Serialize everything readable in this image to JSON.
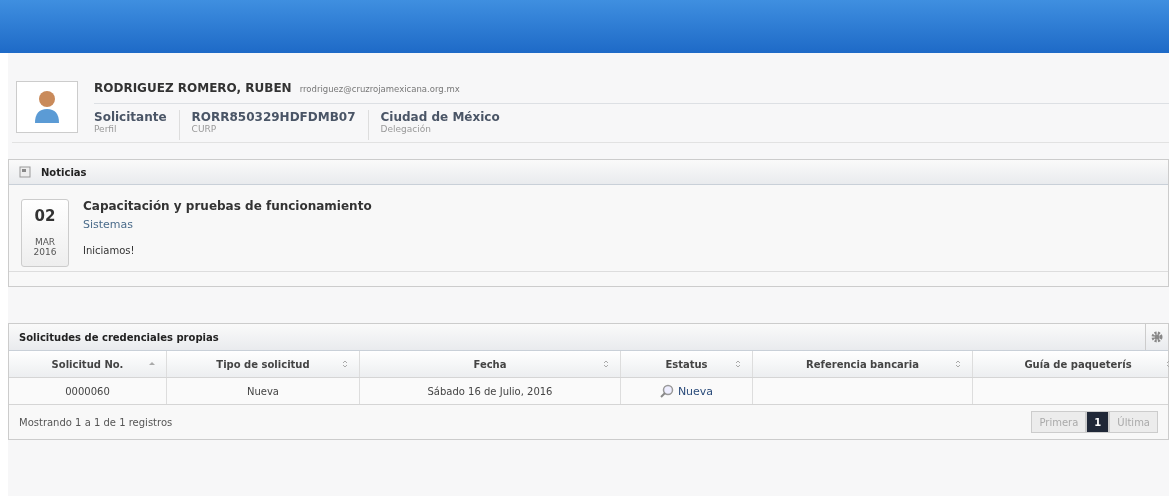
{
  "profile": {
    "name": "RODRIGUEZ ROMERO, RUBEN",
    "email": "rrodriguez@cruzrojamexicana.org.mx",
    "fields": [
      {
        "value": "Solicitante",
        "label": "Perfil"
      },
      {
        "value": "RORR850329HDFDMB07",
        "label": "CURP"
      },
      {
        "value": "Ciudad de México",
        "label": "Delegación"
      }
    ]
  },
  "news": {
    "title": "Noticias",
    "items": [
      {
        "day": "02",
        "month": "MAR",
        "year": "2016",
        "title": "Capacitación y pruebas de funcionamiento",
        "category": "Sistemas",
        "body": "Iniciamos!"
      }
    ]
  },
  "table": {
    "title": "Solicitudes de credenciales propias",
    "columns": [
      {
        "label": "Solicitud No.",
        "sorted": true
      },
      {
        "label": "Tipo de solicitud",
        "sorted": false
      },
      {
        "label": "Fecha",
        "sorted": false
      },
      {
        "label": "Estatus",
        "sorted": false
      },
      {
        "label": "Referencia bancaria",
        "sorted": false
      },
      {
        "label": "Guía de paqueterís",
        "sorted": false
      }
    ],
    "rows": [
      {
        "cells": [
          {
            "kind": "text",
            "text": "0000060"
          },
          {
            "kind": "text",
            "text": "Nueva"
          },
          {
            "kind": "text",
            "text": "Sábado 16 de Julio, 2016"
          },
          {
            "kind": "link",
            "text": "Nueva"
          },
          {
            "kind": "empty"
          },
          {
            "kind": "empty"
          }
        ]
      }
    ],
    "info": "Mostrando 1 a 1 de 1 registros",
    "pager": [
      {
        "label": "Primera",
        "selected": false,
        "disabled": true
      },
      {
        "label": "1",
        "selected": true
      },
      {
        "label": "Última",
        "selected": false,
        "disabled": true
      }
    ]
  }
}
